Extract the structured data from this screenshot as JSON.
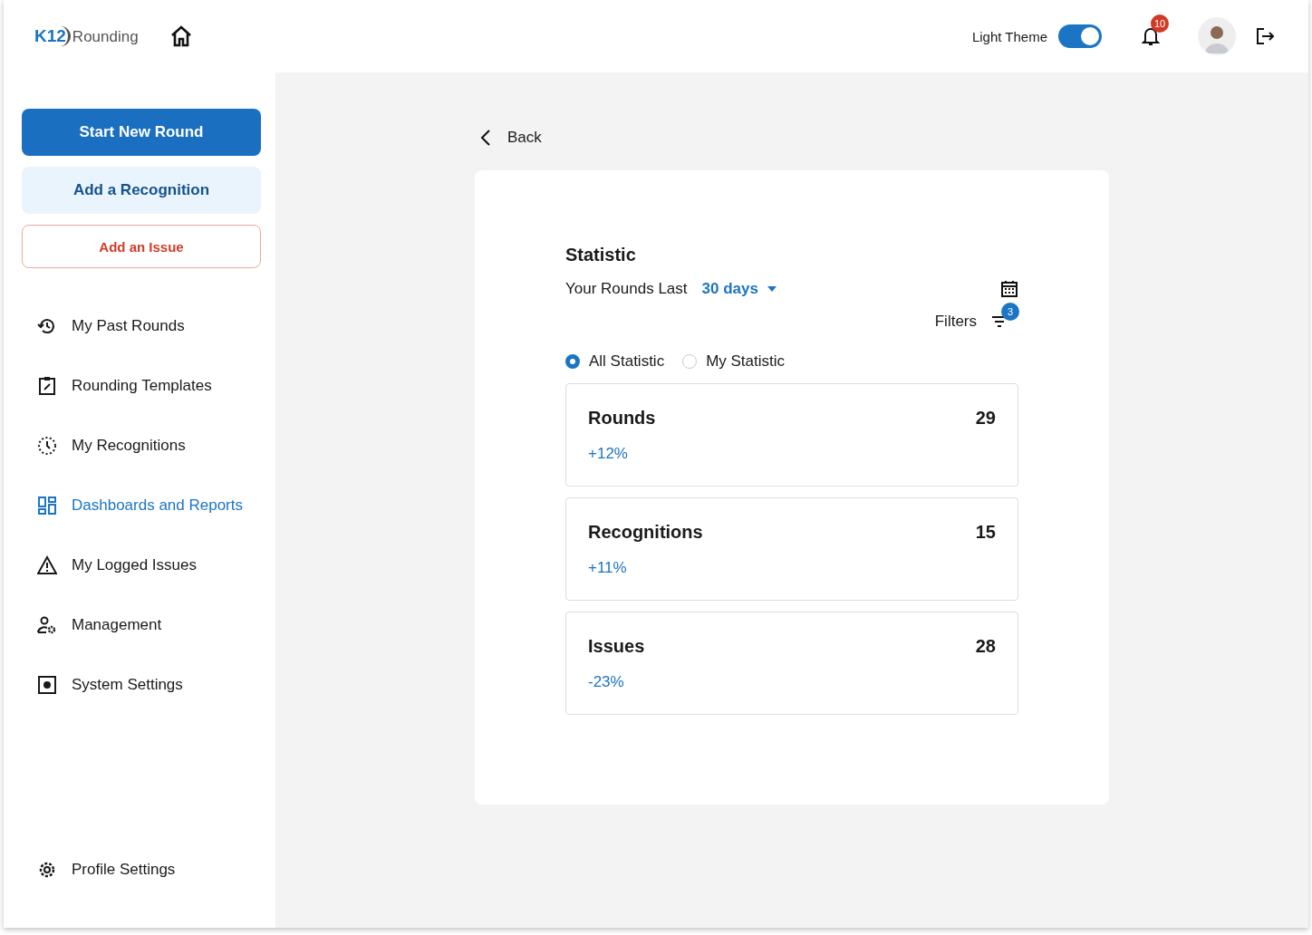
{
  "header": {
    "logo_mark": "K12",
    "logo_text": "Rounding",
    "theme_label": "Light Theme",
    "theme_on": true,
    "notification_count": "10"
  },
  "sidebar": {
    "actions": [
      {
        "label": "Start New Round",
        "kind": "primary"
      },
      {
        "label": "Add a Recognition",
        "kind": "secondary"
      },
      {
        "label": "Add an Issue",
        "kind": "danger"
      }
    ],
    "items": [
      {
        "label": "My Past Rounds",
        "selected": false
      },
      {
        "label": "Rounding Templates",
        "selected": false
      },
      {
        "label": "My Recognitions",
        "selected": false
      },
      {
        "label": "Dashboards and Reports",
        "selected": true
      },
      {
        "label": "My Logged Issues",
        "selected": false
      },
      {
        "label": "Management",
        "selected": false
      },
      {
        "label": "System Settings",
        "selected": false
      }
    ],
    "footer_item": {
      "label": "Profile Settings",
      "selected": false
    }
  },
  "back": "Back",
  "statistic": {
    "title": "Statistic",
    "period_label": "Your Rounds Last",
    "period_value": "30 days",
    "filters_label": "Filters",
    "filters_count": "3",
    "scope": [
      {
        "label": "All Statistic",
        "selected": true
      },
      {
        "label": "My Statistic",
        "selected": false
      }
    ],
    "cards": [
      {
        "title": "Rounds",
        "value": "29",
        "change": "+12%"
      },
      {
        "title": "Recognitions",
        "value": "15",
        "change": "+11%"
      },
      {
        "title": "Issues",
        "value": "28",
        "change": "-23%"
      }
    ]
  }
}
